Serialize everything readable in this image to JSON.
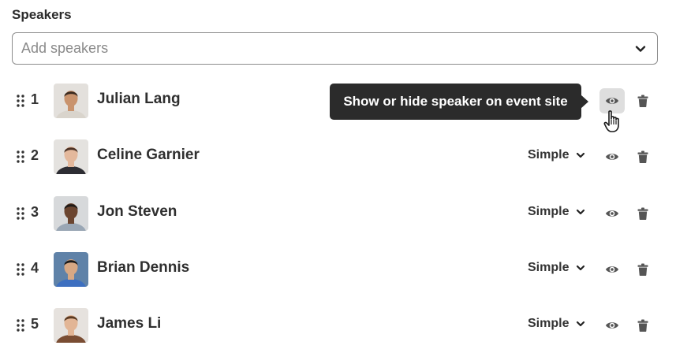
{
  "section": {
    "title": "Speakers"
  },
  "add_speakers": {
    "placeholder": "Add speakers"
  },
  "tooltip": {
    "text": "Show or hide speaker on event site"
  },
  "speakers": [
    {
      "index": "1",
      "name": "Julian Lang",
      "mode": "",
      "skin": "#c9936d",
      "hair": "#3a2a1f",
      "shirt": "#d9d4cc",
      "bg": "#e3e0dc"
    },
    {
      "index": "2",
      "name": "Celine Garnier",
      "mode": "Simple",
      "skin": "#e3b89c",
      "hair": "#4a3124",
      "shirt": "#2d2d33",
      "bg": "#e4e2df"
    },
    {
      "index": "3",
      "name": "Jon Steven",
      "mode": "Simple",
      "skin": "#6b4530",
      "hair": "#1f1a17",
      "shirt": "#9aa7b5",
      "bg": "#d7d9db"
    },
    {
      "index": "4",
      "name": "Brian Dennis",
      "mode": "Simple",
      "skin": "#d7a884",
      "hair": "#1b1b1b",
      "shirt": "#3d6fc0",
      "bg": "#5f82a8"
    },
    {
      "index": "5",
      "name": "James Li",
      "mode": "Simple",
      "skin": "#e2b595",
      "hair": "#5a3a22",
      "shirt": "#7a4d33",
      "bg": "#e6e2de"
    }
  ]
}
